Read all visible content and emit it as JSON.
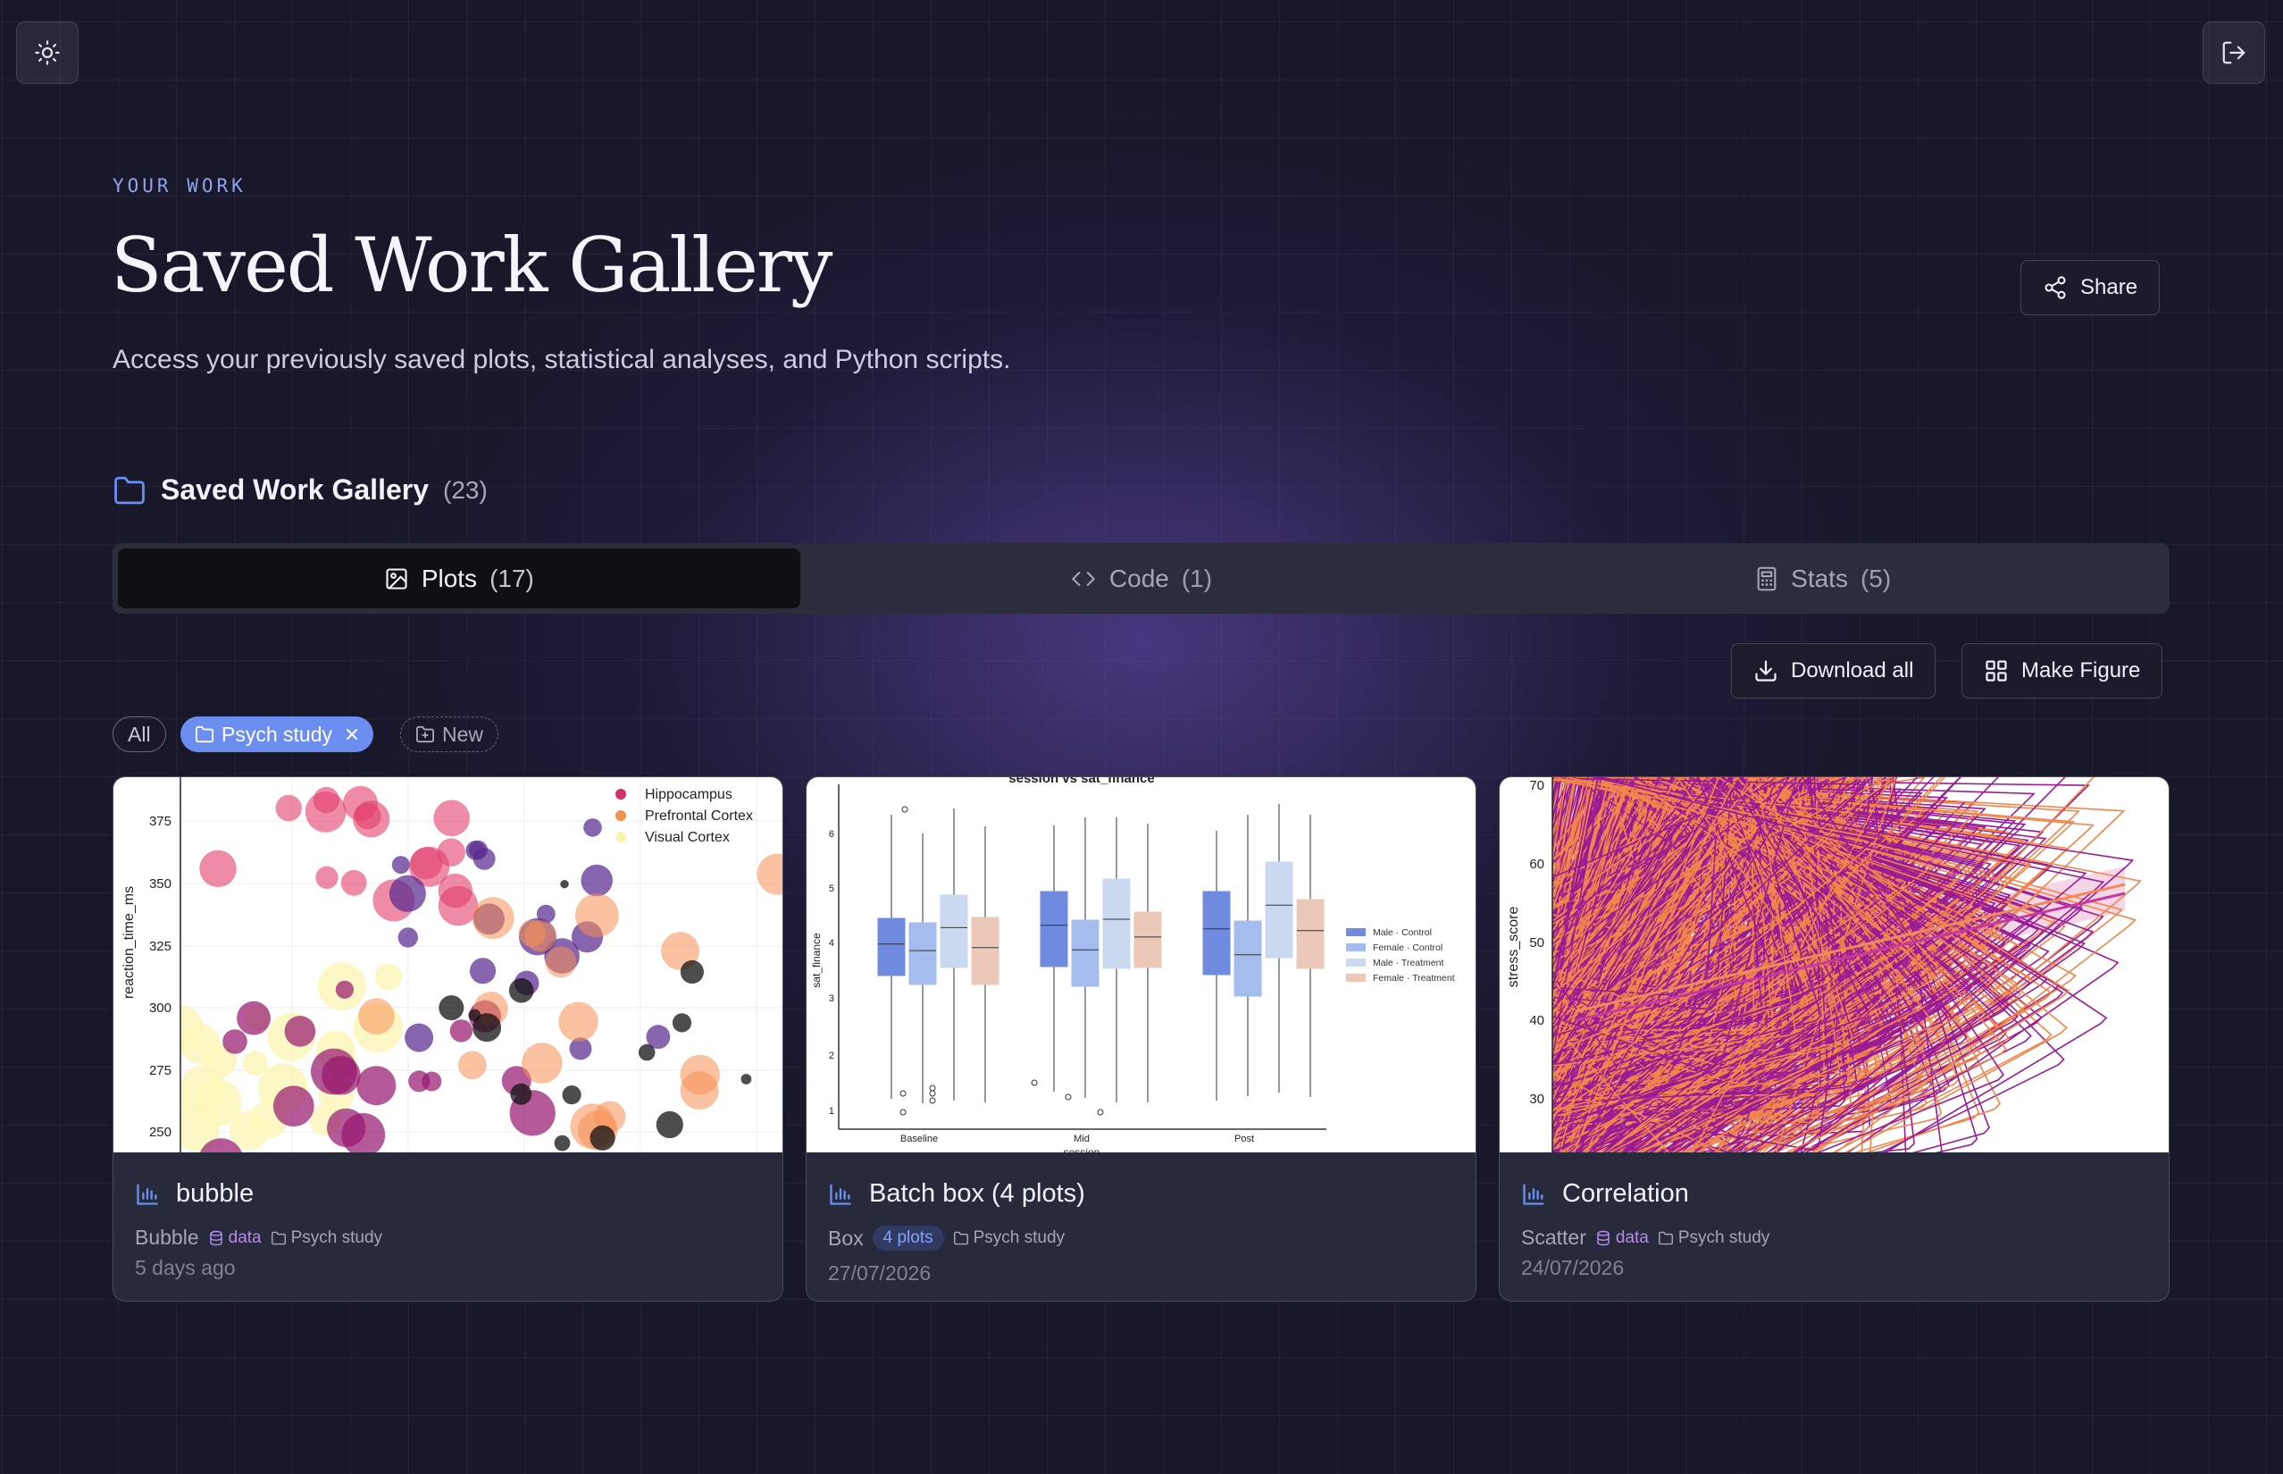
{
  "header": {
    "theme_icon": "sun-icon",
    "logout_icon": "logout-icon",
    "eyebrow": "YOUR WORK",
    "title": "Saved Work Gallery",
    "subtitle": "Access your previously saved plots, statistical analyses, and Python scripts.",
    "share_label": "Share"
  },
  "section": {
    "title": "Saved Work Gallery",
    "count": "(23)"
  },
  "tabs": [
    {
      "label": "Plots",
      "count": "(17)",
      "icon": "image-icon",
      "active": true
    },
    {
      "label": "Code",
      "count": "(1)",
      "icon": "code-icon",
      "active": false
    },
    {
      "label": "Stats",
      "count": "(5)",
      "icon": "calculator-icon",
      "active": false
    }
  ],
  "actions": {
    "download_all": "Download all",
    "make_figure": "Make Figure"
  },
  "filters": {
    "all": "All",
    "active_project": "Psych study",
    "new": "New"
  },
  "colors": {
    "accent": "#6b8ef0",
    "tag_purple": "#b689ec",
    "pill_blue": "#7ea2ff"
  },
  "cards": [
    {
      "title": "bubble",
      "type": "Bubble",
      "data_tag": "data",
      "project": "Psych study",
      "date": "5 days ago",
      "chart": {
        "type": "scatter",
        "ylabel": "reaction_time_ms",
        "yticks": [
          "375",
          "350",
          "325",
          "300",
          "275",
          "250"
        ],
        "legend": [
          "Hippocampus",
          "Prefrontal Cortex",
          "Visual Cortex"
        ]
      }
    },
    {
      "title": "Batch box (4 plots)",
      "type": "Box",
      "pill": "4 plots",
      "project": "Psych study",
      "date": "27/07/2026",
      "chart": {
        "type": "box",
        "title": "session vs sat_finance",
        "xlabel": "session",
        "ylabel": "sat_finance",
        "categories": [
          "Baseline",
          "Mid",
          "Post"
        ],
        "yticks": [
          "6",
          "5",
          "4",
          "3",
          "2",
          "1"
        ],
        "legend": [
          "Male · Control",
          "Female · Control",
          "Male · Treatment",
          "Female · Treatment"
        ]
      }
    },
    {
      "title": "Correlation",
      "type": "Scatter",
      "data_tag": "data",
      "project": "Psych study",
      "date": "24/07/2026",
      "chart": {
        "type": "scatter",
        "ylabel": "stress_score",
        "yticks": [
          "70",
          "60",
          "50",
          "40",
          "30"
        ]
      }
    }
  ]
}
